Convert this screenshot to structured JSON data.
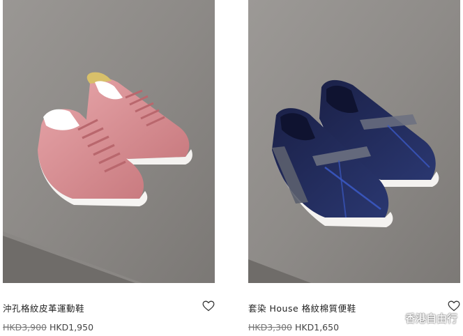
{
  "products": [
    {
      "name": "沖孔格紋皮革運動鞋",
      "original_price": "HKD3,900",
      "sale_price": "HKD1,950",
      "image_alt": "pink leather sneaker",
      "wishlist_icon": "heart-outline-icon"
    },
    {
      "name": "套染 House 格紋棉質便鞋",
      "original_price": "HKD3,300",
      "sale_price": "HKD1,650",
      "image_alt": "navy check slip-on sneaker",
      "wishlist_icon": "heart-outline-icon"
    }
  ],
  "watermark": {
    "text": "香港自由行",
    "icon": "wechat-logo-icon"
  },
  "colors": {
    "pink_shoe": "#d98a8f",
    "navy_shoe": "#1e2850",
    "check_accent": "#3a58c2",
    "background_stone": "#8d8a87"
  }
}
